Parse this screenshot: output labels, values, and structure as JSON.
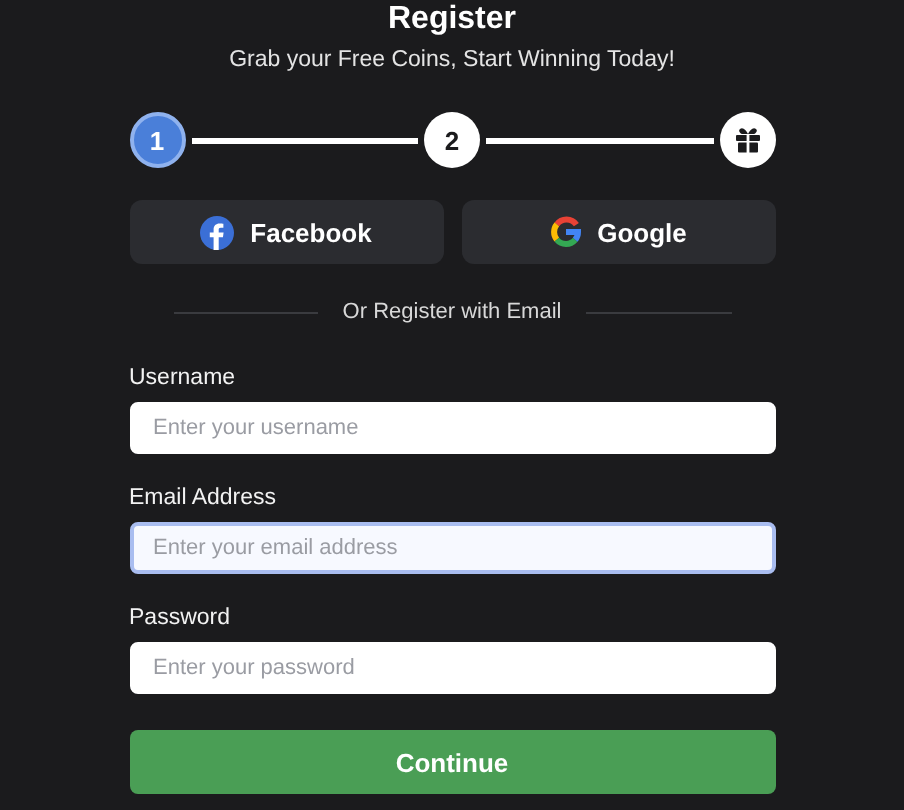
{
  "header": {
    "title": "Register",
    "subtitle": "Grab your Free Coins, Start Winning Today!"
  },
  "steps": [
    {
      "kind": "number",
      "label": "1",
      "selected": true
    },
    {
      "kind": "number",
      "label": "2",
      "selected": false
    },
    {
      "kind": "gift",
      "selected": false
    }
  ],
  "social_buttons": [
    {
      "kind": "facebook",
      "label": "Facebook"
    },
    {
      "kind": "google",
      "label": "Google"
    }
  ],
  "divider_text": "Or Register with Email",
  "fields": [
    {
      "label": "Username",
      "placeholder": "Enter your username",
      "focused": false
    },
    {
      "label": "Email Address",
      "placeholder": "Enter your email address",
      "focused": true
    },
    {
      "label": "Password",
      "placeholder": "Enter your password",
      "focused": false
    }
  ],
  "submit_button": "Continue"
}
